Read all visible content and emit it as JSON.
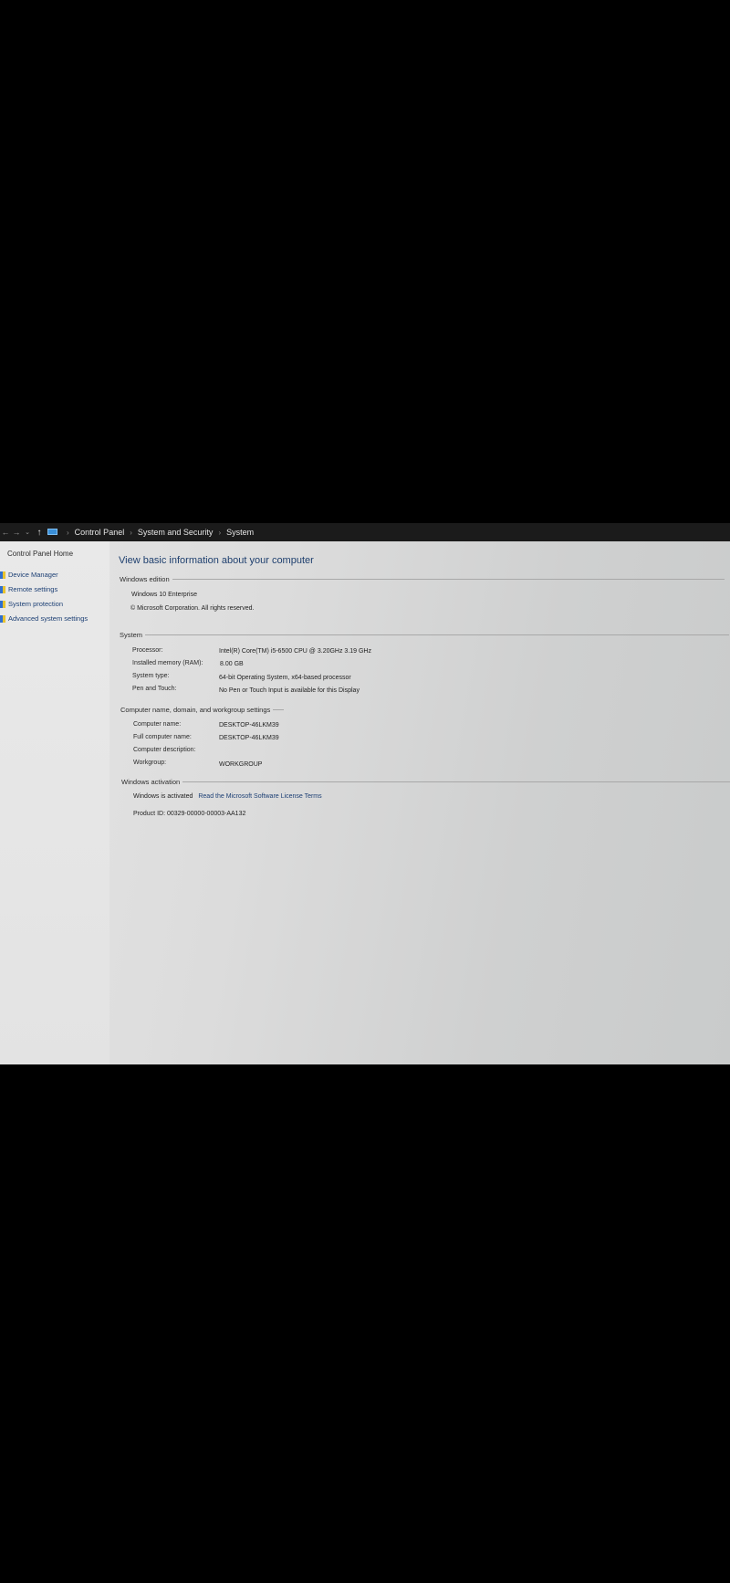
{
  "address_bar": {
    "breadcrumbs": [
      "Control Panel",
      "System and Security",
      "System"
    ]
  },
  "sidebar": {
    "home": "Control Panel Home",
    "items": [
      {
        "label": "Device Manager"
      },
      {
        "label": "Remote settings"
      },
      {
        "label": "System protection"
      },
      {
        "label": "Advanced system settings"
      }
    ]
  },
  "main": {
    "title": "View basic information about your computer",
    "windows_edition": {
      "heading": "Windows edition",
      "edition": "Windows 10 Enterprise",
      "copyright": "© Microsoft Corporation. All rights reserved."
    },
    "system": {
      "heading": "System",
      "rows": [
        {
          "label": "Processor:",
          "value": "Intel(R) Core(TM) i5-6500 CPU @ 3.20GHz   3.19 GHz"
        },
        {
          "label": "Installed memory (RAM):",
          "value": "8.00 GB"
        },
        {
          "label": "System type:",
          "value": "64-bit Operating System, x64-based processor"
        },
        {
          "label": "Pen and Touch:",
          "value": "No Pen or Touch Input is available for this Display"
        }
      ]
    },
    "computer_name": {
      "heading": "Computer name, domain, and workgroup settings",
      "rows": [
        {
          "label": "Computer name:",
          "value": "DESKTOP-46LKM39"
        },
        {
          "label": "Full computer name:",
          "value": "DESKTOP-46LKM39"
        },
        {
          "label": "Computer description:",
          "value": ""
        },
        {
          "label": "Workgroup:",
          "value": "WORKGROUP"
        }
      ]
    },
    "activation": {
      "heading": "Windows activation",
      "status": "Windows is activated",
      "license_link": "Read the Microsoft Software License Terms",
      "product_id": "Product ID: 00329-00000-00003-AA132"
    }
  },
  "colors": {
    "link": "#1c3f74",
    "background": "#000000",
    "screen": "#dcdcdc"
  }
}
